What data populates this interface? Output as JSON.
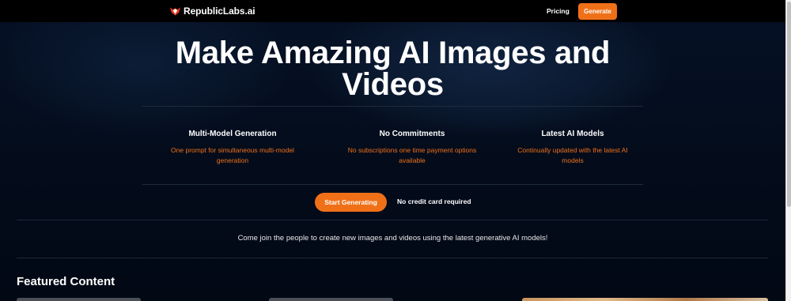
{
  "navbar": {
    "brand": "RepublicLabs.ai",
    "pricing_label": "Pricing",
    "generate_label": "Generate"
  },
  "hero": {
    "title_line1": "Make Amazing AI Images and",
    "title_line2": "Videos"
  },
  "features": [
    {
      "title": "Multi-Model Generation",
      "desc_line1": "One prompt for simultaneous multi-model",
      "desc_line2": "generation"
    },
    {
      "title": "No Commitments",
      "desc_line1": "No subscriptions one time payment options",
      "desc_line2": "available"
    },
    {
      "title": "Latest AI Models",
      "desc_line1": "Continually updated with the latest AI",
      "desc_line2": "models"
    }
  ],
  "cta": {
    "button_label": "Start Generating",
    "note": "No credit card required"
  },
  "join_text": "Come join the people to create new images and videos using the latest generative AI models!",
  "featured": {
    "title": "Featured Content"
  },
  "colors": {
    "accent": "#f07018",
    "background": "#040d1d",
    "navbar": "#000000"
  },
  "icons": {
    "brand_logo": "republic-labs-logo-icon"
  }
}
